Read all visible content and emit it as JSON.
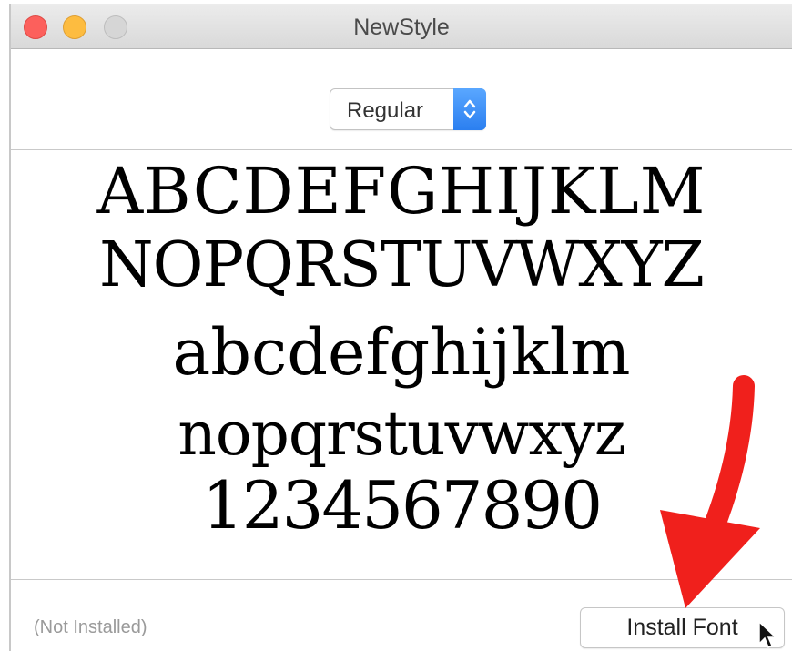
{
  "window": {
    "title": "NewStyle",
    "buttons": [
      "close",
      "minimize",
      "zoom"
    ]
  },
  "style_selector": {
    "selected": "Regular",
    "icon": "updown-chevron-icon"
  },
  "preview": {
    "uppercase_line1": "ABCDEFGHIJKLM",
    "uppercase_line2": "NOPQRSTUVWXYZ",
    "lowercase_line1": "abcdefghijklm",
    "lowercase_line2": "nopqrstuvwxyz",
    "digits": "1234567890"
  },
  "footer": {
    "status": "(Not Installed)",
    "install_label": "Install Font"
  },
  "annotations": {
    "arrow_color": "#f0201c",
    "arrow_icon": "red-arrow-icon",
    "cursor_icon": "mouse-pointer-icon"
  },
  "colors": {
    "accent": "#2b7ff0",
    "close": "#fc605c",
    "minimize": "#fdbc40",
    "zoom": "#d6d6d6"
  }
}
